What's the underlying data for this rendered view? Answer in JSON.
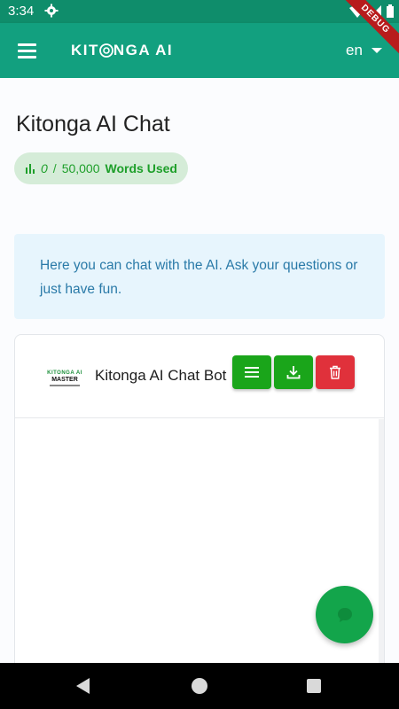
{
  "status_bar": {
    "time": "3:34",
    "debug_label": "DEBUG",
    "icons": [
      "gear-icon",
      "wifi-icon",
      "signal-icon",
      "battery-icon"
    ]
  },
  "app_bar": {
    "brand": "KITONGA AI",
    "brand_part1": "KIT",
    "brand_part2": "NGA AI",
    "language": "en",
    "colors": {
      "primary": "#12a07f",
      "status": "#0f8d6b"
    }
  },
  "page": {
    "title": "Kitonga AI Chat",
    "usage": {
      "used": "0",
      "separator": "/",
      "limit": "50,000",
      "label": "Words Used",
      "color": "#1e9f2a"
    },
    "info": "Here you can chat with the AI. Ask your questions or just have fun."
  },
  "chat": {
    "logo_line1": "KITONGA AI",
    "logo_line2": "MASTER",
    "title": "Kitonga AI Chat Bot",
    "buttons": {
      "menu_color": "#1aa51a",
      "download_color": "#1aa51a",
      "delete_color": "#e0313b"
    }
  },
  "fab": {
    "icon": "chat-bubble-icon",
    "color": "#13a54b"
  },
  "nav": {
    "icons": [
      "back-icon",
      "home-icon",
      "recent-apps-icon"
    ]
  }
}
